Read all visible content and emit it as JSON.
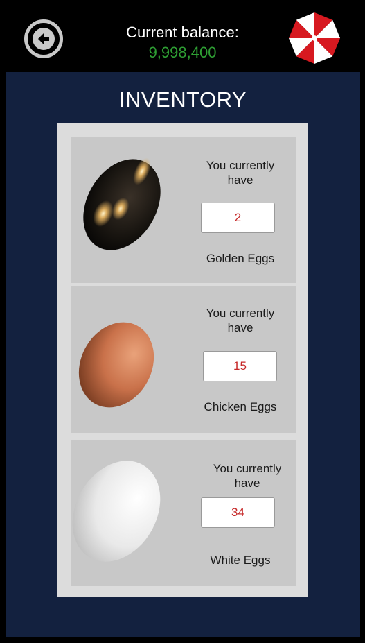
{
  "header": {
    "back_icon": "back-arrow-circle-icon",
    "balance_label": "Current balance:",
    "balance_value": "9,998,400",
    "logo_icon": "umbrella-logo-icon",
    "colors": {
      "balance": "#2e9e33",
      "background": "#000000"
    }
  },
  "main": {
    "title": "INVENTORY",
    "background": "#13213f",
    "items": [
      {
        "text": "You currently have",
        "count": "2",
        "name": "Golden Eggs",
        "icon": "golden-egg-icon"
      },
      {
        "text": "You currently have",
        "count": "15",
        "name": "Chicken Eggs",
        "icon": "chicken-egg-icon"
      },
      {
        "text": "You currently have",
        "count": "34",
        "name": "White Eggs",
        "icon": "white-egg-icon"
      }
    ]
  }
}
